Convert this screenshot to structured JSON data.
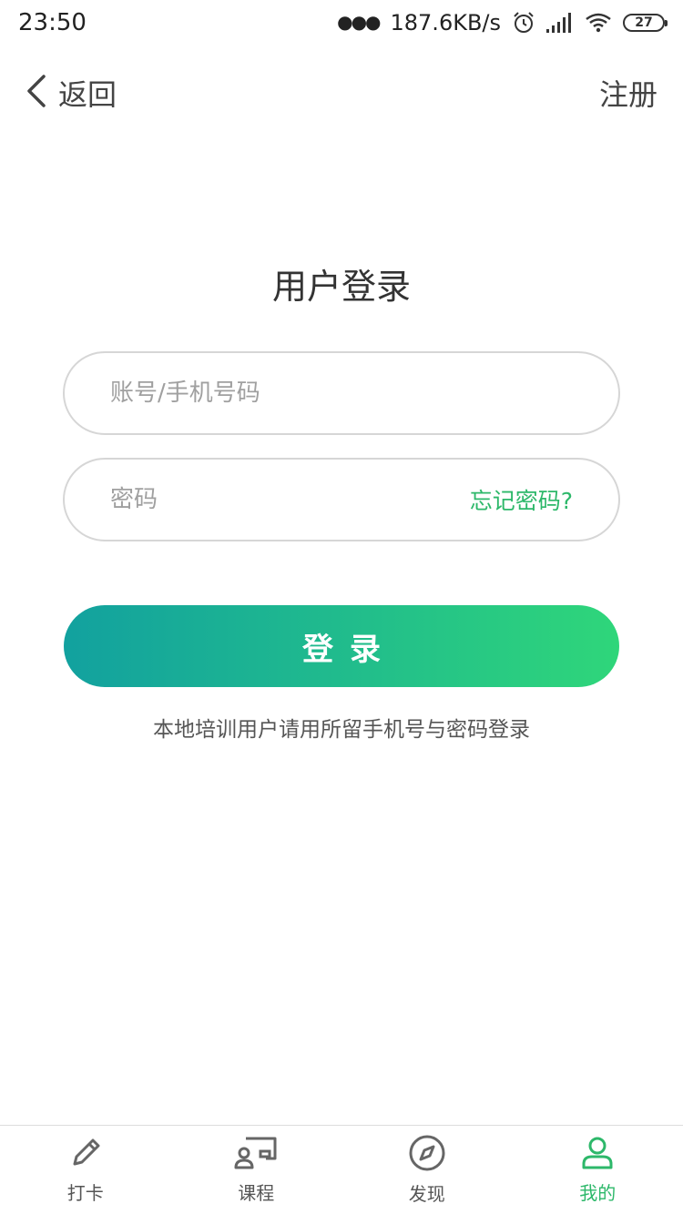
{
  "status_bar": {
    "time": "23:50",
    "network_speed": "187.6KB/s",
    "battery": "27",
    "icons": [
      "alarm-icon",
      "signal-icon",
      "wifi-icon",
      "battery-icon"
    ]
  },
  "nav": {
    "back_label": "返回",
    "register_label": "注册"
  },
  "login": {
    "title": "用户登录",
    "account_placeholder": "账号/手机号码",
    "account_value": "",
    "password_placeholder": "密码",
    "password_value": "",
    "forgot_label": "忘记密码?",
    "submit_label": "登录",
    "hint": "本地培训用户请用所留手机号与密码登录"
  },
  "tabs": [
    {
      "label": "打卡",
      "icon": "pencil-icon",
      "active": false
    },
    {
      "label": "课程",
      "icon": "course-icon",
      "active": false
    },
    {
      "label": "发现",
      "icon": "compass-icon",
      "active": false
    },
    {
      "label": "我的",
      "icon": "user-icon",
      "active": true
    }
  ],
  "colors": {
    "accent": "#2db86a",
    "gradient_start": "#12a19f",
    "gradient_end": "#2fd67a",
    "field_border": "#d6d6d6"
  }
}
